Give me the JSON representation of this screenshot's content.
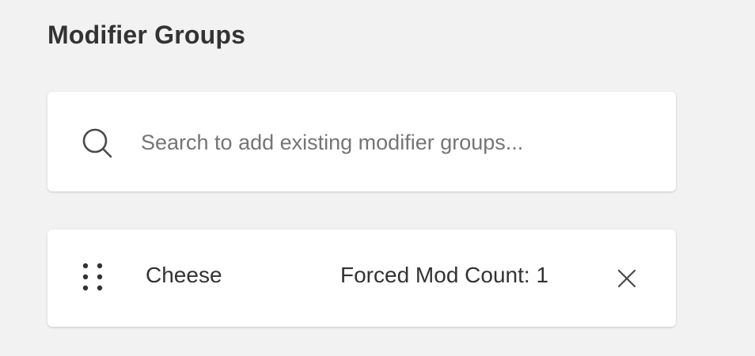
{
  "section": {
    "title": "Modifier Groups"
  },
  "search": {
    "icon": "search-icon",
    "placeholder": "Search to add existing modifier groups...",
    "value": ""
  },
  "modifier_groups": [
    {
      "name": "Cheese",
      "forced_mod_count_text": "Forced Mod Count: 1",
      "drag_icon": "drag-handle-icon",
      "remove_icon": "close-icon"
    }
  ],
  "colors": {
    "background": "#f2f2f2",
    "card": "#ffffff",
    "text": "#333333",
    "placeholder": "#757575",
    "icon": "#4a4a4a"
  }
}
